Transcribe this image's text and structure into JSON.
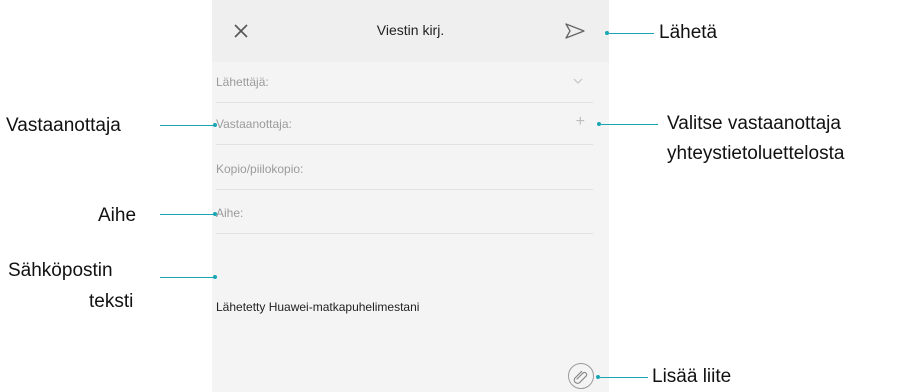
{
  "app": {
    "title": "Viestin kirj.",
    "close_icon": "close-icon",
    "send_icon": "send-icon"
  },
  "fields": {
    "sender": {
      "label": "Lähettäjä:",
      "action_icon": "chevron-down-icon"
    },
    "to": {
      "label": "Vastaanottaja:",
      "action": "+"
    },
    "cc": {
      "label": "Kopio/piilokopio:"
    },
    "subject": {
      "label": "Aihe:"
    }
  },
  "body": {
    "signature": "Lähetetty Huawei-matkapuhelimestani"
  },
  "attach": {
    "icon": "paperclip-icon"
  },
  "callouts": {
    "send": "Lähetä",
    "recipient": "Vastaanottaja",
    "choose_contact_line1": "Valitse vastaanottaja",
    "choose_contact_line2": "yhteystietoluettelosta",
    "subject": "Aihe",
    "body_line1": "Sähköpostin",
    "body_line2": "teksti",
    "attachment": "Lisää liite"
  },
  "colors": {
    "accent": "#1aa5b3",
    "screen_bg": "#f4f4f4",
    "topbar_bg": "#efefef"
  }
}
